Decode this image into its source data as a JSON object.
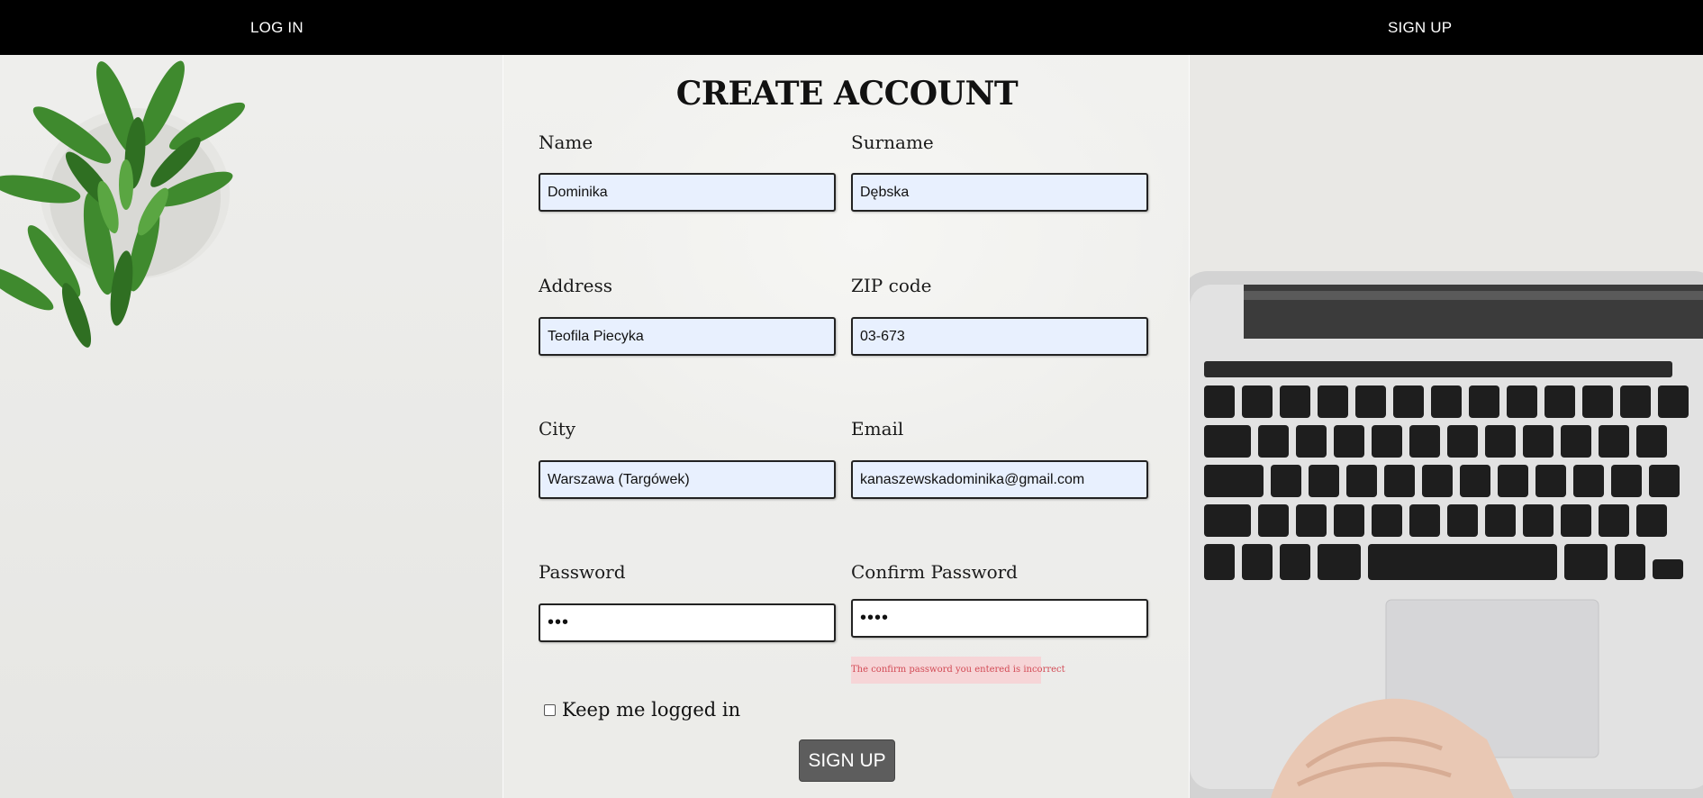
{
  "nav": {
    "login_label": "LOG IN",
    "signup_label": "SIGN UP"
  },
  "form": {
    "title": "CREATE ACCOUNT",
    "fields": {
      "name": {
        "label": "Name",
        "value": "Dominika"
      },
      "surname": {
        "label": "Surname",
        "value": "Dębska"
      },
      "address": {
        "label": "Address",
        "value": "Teofila Piecyka"
      },
      "zip": {
        "label": "ZIP code",
        "value": "03-673"
      },
      "city": {
        "label": "City",
        "value": "Warszawa (Targówek)"
      },
      "email": {
        "label": "Email",
        "value": "kanaszewskadominika@gmail.com"
      },
      "password": {
        "label": "Password",
        "value": "•••"
      },
      "confirm_password": {
        "label": "Confirm Password",
        "value": "••••"
      }
    },
    "error_message": "The confirm password you entered is incorrect",
    "keep_logged_in": {
      "label": "Keep me logged in",
      "checked": false
    },
    "submit_label": "SIGN UP"
  },
  "colors": {
    "topbar": "#000000",
    "input_autofill": "#e8f0fe",
    "error_bg": "#f6d5d7",
    "error_text": "#d24a55",
    "button": "#5d5d5d"
  },
  "icons": [
    "plant-decoration",
    "laptop-decoration"
  ]
}
